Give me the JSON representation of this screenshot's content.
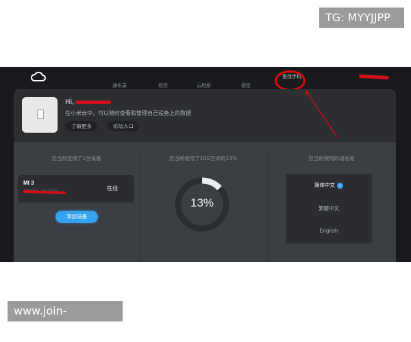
{
  "watermarks": {
    "top": "TG: MYYJJPP",
    "bottom": "www.join-wbty.com"
  },
  "nav": {
    "items": [
      {
        "label": "通讯录"
      },
      {
        "label": "短信"
      },
      {
        "label": "云相册"
      },
      {
        "label": "便签"
      }
    ],
    "find_phone": "查找手机"
  },
  "profile": {
    "greeting": "Hi,",
    "subtitle": "在小米云中，可以随时查看和管理自己设备上的数据",
    "learn_more": "了解更多",
    "forum": "论坛入口"
  },
  "devices": {
    "title": "您当前连接了1台设备",
    "items": [
      {
        "name": "MI 3",
        "id": "1003C...333386",
        "status": "在线"
      }
    ],
    "add_label": "添加设备"
  },
  "storage": {
    "title": "您当前使用了10G空间的13%",
    "percent_label": "13%",
    "used_fraction": 0.13
  },
  "language": {
    "title": "您当前使用的语言是",
    "options": [
      {
        "label": "简体中文",
        "selected": true
      },
      {
        "label": "繁體中文",
        "selected": false
      },
      {
        "label": "English",
        "selected": false
      }
    ]
  },
  "colors": {
    "accent": "#35a2ef",
    "annotation_red": "#e00a0a",
    "panel": "#3b3e43",
    "background": "#181a1d"
  }
}
